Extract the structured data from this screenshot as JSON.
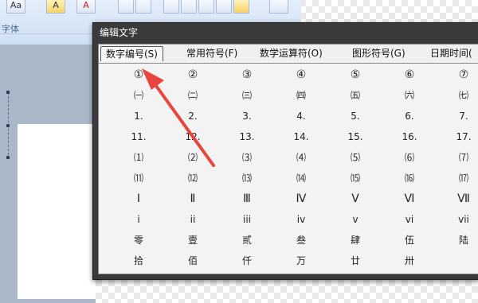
{
  "ribbon": {
    "group_label": "字体",
    "buttons": [
      "Aa",
      "A",
      "A"
    ]
  },
  "dialog": {
    "title": "编辑文字",
    "tabs": [
      {
        "label": "数字编号(S)",
        "active": true
      },
      {
        "label": "常用符号(F)",
        "active": false
      },
      {
        "label": "数学运算符(O)",
        "active": false
      },
      {
        "label": "图形符号(G)",
        "active": false
      },
      {
        "label": "日期时间(",
        "active": false
      }
    ],
    "symbol_rows": [
      [
        "①",
        "②",
        "③",
        "④",
        "⑤",
        "⑥",
        "⑦"
      ],
      [
        "㈠",
        "㈡",
        "㈢",
        "㈣",
        "㈤",
        "㈥",
        "㈦"
      ],
      [
        "1.",
        "2.",
        "3.",
        "4.",
        "5.",
        "6.",
        "7."
      ],
      [
        "11.",
        "12.",
        "13.",
        "14.",
        "15.",
        "16.",
        "17."
      ],
      [
        "⑴",
        "⑵",
        "⑶",
        "⑷",
        "⑸",
        "⑹",
        "⑺"
      ],
      [
        "⑾",
        "⑿",
        "⒀",
        "⒁",
        "⒂",
        "⒃",
        "⒄"
      ],
      [
        "Ⅰ",
        "Ⅱ",
        "Ⅲ",
        "Ⅳ",
        "Ⅴ",
        "Ⅵ",
        "Ⅶ"
      ],
      [
        "i",
        "ii",
        "iii",
        "iv",
        "v",
        "vi",
        "vii"
      ],
      [
        "零",
        "壹",
        "贰",
        "叁",
        "肆",
        "伍",
        "陆"
      ],
      [
        "拾",
        "佰",
        "仟",
        "万",
        "廿",
        "卅",
        ""
      ]
    ]
  },
  "colors": {
    "dialog_frame": "#3a3a3a",
    "panel_bg": "#f3f3f3",
    "ribbon_bg": "#dbe7f6",
    "arrow": "#e8453c"
  }
}
